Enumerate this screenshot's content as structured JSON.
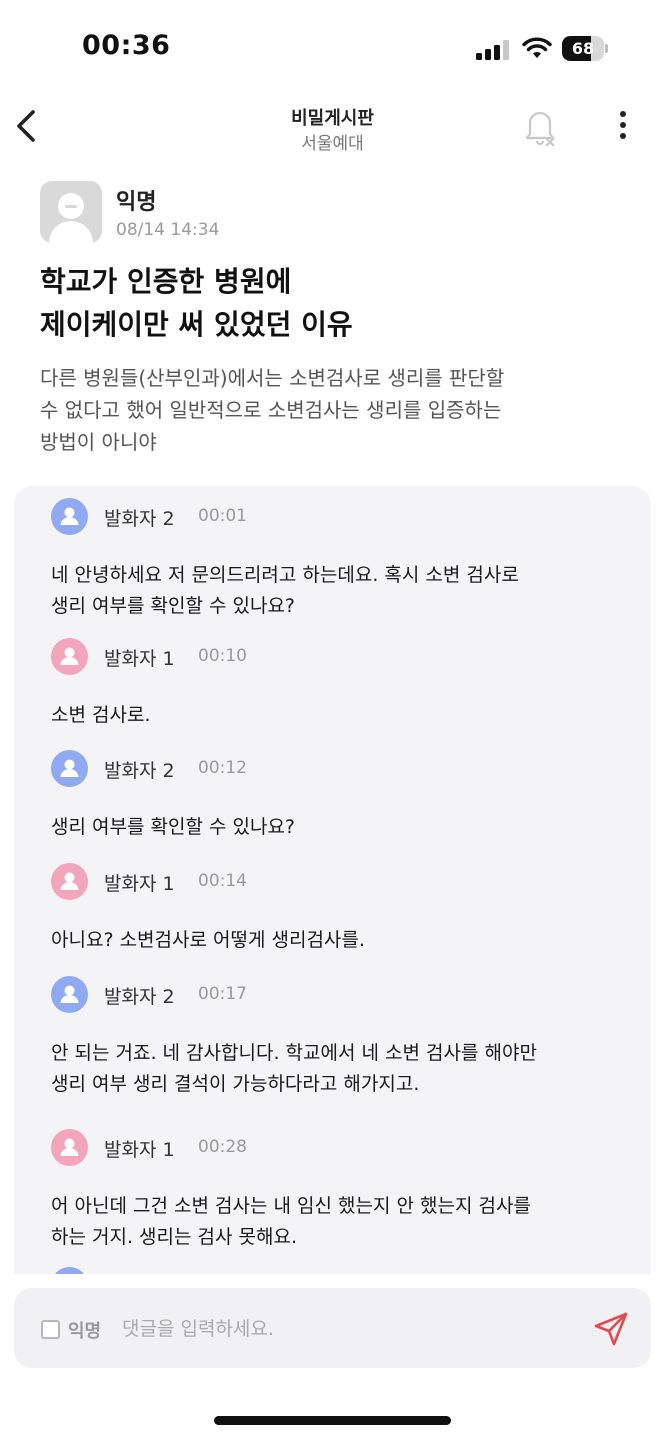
{
  "status_bar": {
    "time": "00:36",
    "battery": "68",
    "battery_level": 0.68
  },
  "header": {
    "title": "비밀게시판",
    "subtitle": "서울예대"
  },
  "post": {
    "author": "익명",
    "date": "08/14 14:34",
    "title_lines": [
      "학교가 인증한 병원에",
      "제이케이만 써 있었던 이유"
    ],
    "body_lines": [
      "다른 병원들(산부인과)에서는 소변검사로 생리를 판단할",
      "수 없다고 했어 일반적으로 소변검사는 생리를 입증하는",
      "방법이 아니야"
    ]
  },
  "transcript": [
    {
      "speaker": "발화자 2",
      "time": "00:01",
      "color": "#8faaf0",
      "lines": [
        "네 안녕하세요 저 문의드리려고 하는데요. 혹시 소변 검사로",
        "생리 여부를 확인할 수 있나요?"
      ]
    },
    {
      "speaker": "발화자 1",
      "time": "00:10",
      "color": "#f2a5bb",
      "lines": [
        "소변 검사로."
      ]
    },
    {
      "speaker": "발화자 2",
      "time": "00:12",
      "color": "#8faaf0",
      "lines": [
        "생리 여부를 확인할 수 있나요?"
      ]
    },
    {
      "speaker": "발화자 1",
      "time": "00:14",
      "color": "#f2a5bb",
      "lines": [
        "아니요? 소변검사로 어떻게 생리검사를."
      ]
    },
    {
      "speaker": "발화자 2",
      "time": "00:17",
      "color": "#8faaf0",
      "lines": [
        "안 되는 거죠. 네 감사합니다. 학교에서 네 소변 검사를 해야만",
        "생리 여부 생리 결석이 가능하다라고 해가지고."
      ]
    },
    {
      "speaker": "발화자 1",
      "time": "00:28",
      "color": "#f2a5bb",
      "lines": [
        "어 아닌데 그건 소변 검사는 내 임신 했는지 안 했는지 검사를",
        "하는 거지. 생리는 검사 못해요."
      ]
    }
  ],
  "comment_bar": {
    "anon_label": "익명",
    "placeholder": "댓글을 입력하세요.",
    "value": ""
  },
  "colors": {
    "accent_send": "#e5484d",
    "speaker_blue": "#8faaf0",
    "speaker_pink": "#f2a5bb"
  },
  "icons": {
    "back": "chevron-left-icon",
    "bell": "bell-off-icon",
    "more": "more-vertical-icon",
    "send": "send-icon"
  }
}
